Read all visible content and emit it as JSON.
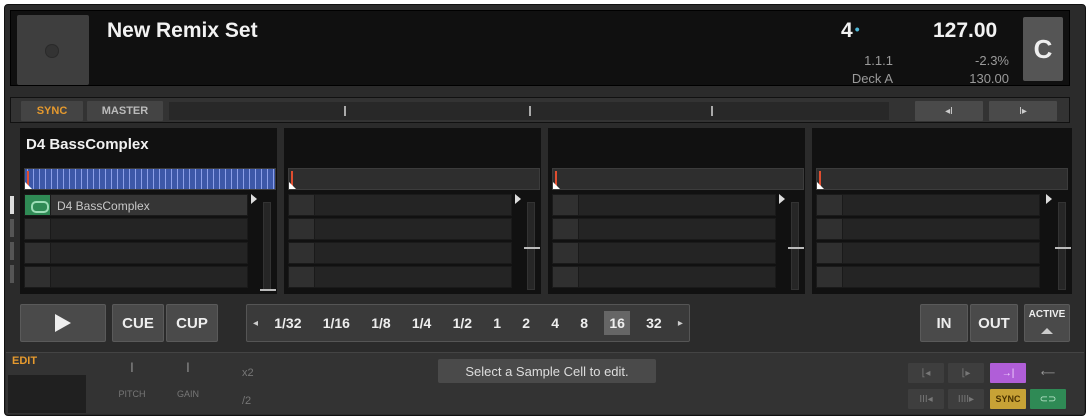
{
  "header": {
    "title": "New Remix Set",
    "beats": "4",
    "beat_dot": "•",
    "position": "1.1.1",
    "deck": "Deck A",
    "bpm": "127.00",
    "tempo_offset": "-2.3%",
    "original_bpm": "130.00",
    "deck_letter": "C"
  },
  "syncbar": {
    "sync_label": "SYNC",
    "master_label": "MASTER",
    "jump_back": "◂I",
    "jump_fwd": "I▸"
  },
  "slots": [
    {
      "name": "D4 BassComplex",
      "cell_label": "D4 BassComplex"
    },
    {
      "name": "",
      "cell_label": ""
    },
    {
      "name": "",
      "cell_label": ""
    },
    {
      "name": "",
      "cell_label": ""
    }
  ],
  "transport": {
    "cue_label": "CUE",
    "cup_label": "CUP",
    "sizes": [
      "1/32",
      "1/16",
      "1/8",
      "1/4",
      "1/2",
      "1",
      "2",
      "4",
      "8",
      "16",
      "32"
    ],
    "selected_size": "16",
    "prev_arrow": "◂",
    "next_arrow": "▸",
    "in_label": "IN",
    "out_label": "OUT",
    "active_label": "ACTIVE"
  },
  "bottom": {
    "edit_label": "EDIT",
    "pitch_label": "PITCH",
    "gain_label": "GAIN",
    "knob_glyph": "I",
    "mult_x2": "x2",
    "mult_div2": "/2",
    "message": "Select a Sample Cell to edit.",
    "sync_label": "SYNC"
  },
  "colors": {
    "sync_orange": "#e69a2e",
    "beat_dot_blue": "#4fb8d8",
    "loop_green": "#2f8a55",
    "reverse_purple": "#b05ed8"
  }
}
